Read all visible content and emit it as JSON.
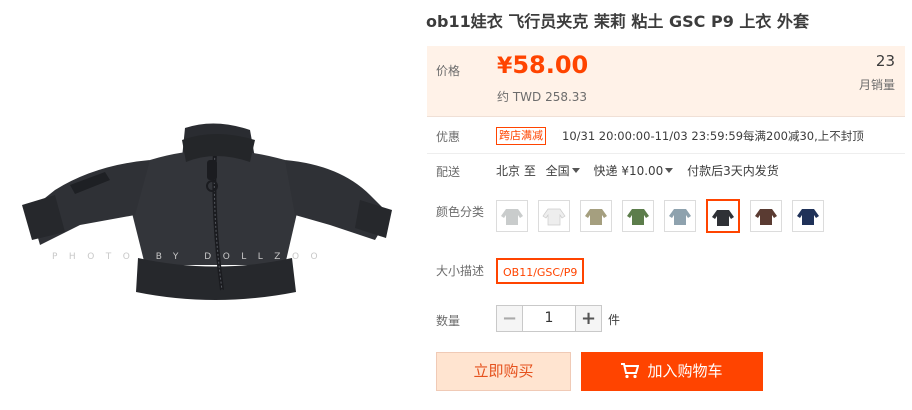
{
  "product": {
    "title": "ob11娃衣 飞行员夹克 茉莉 粘土 GSC P9 上衣 外套",
    "image": {
      "watermark": "PHOTO BY DOLLZOO",
      "icon": "jacket-photo"
    }
  },
  "price": {
    "label": "价格",
    "currency": "¥",
    "amount": "58.00",
    "twd": "约 TWD 258.33",
    "sales_count": "23",
    "sales_label": "月销量"
  },
  "promo": {
    "label": "优惠",
    "tag": "跨店满减",
    "text": "10/31 20:00:00-11/03 23:59:59每满200减30,上不封顶"
  },
  "shipping": {
    "label": "配送",
    "from": "北京 至",
    "to": "全国",
    "method": "快递 ¥10.00",
    "note": "付款后3天内发货"
  },
  "color": {
    "label": "颜色分类",
    "options": [
      {
        "name": "light-gray",
        "color": "#c9cccc"
      },
      {
        "name": "white",
        "color": "#eeeeee"
      },
      {
        "name": "khaki",
        "color": "#a59f7f"
      },
      {
        "name": "green",
        "color": "#5c7d4b"
      },
      {
        "name": "blue-gray",
        "color": "#8ea2ae"
      },
      {
        "name": "black",
        "color": "#2f3136"
      },
      {
        "name": "brown",
        "color": "#5a3b32"
      },
      {
        "name": "navy",
        "color": "#1f3158"
      }
    ],
    "selected_index": 5
  },
  "size": {
    "label": "大小描述",
    "option": "OB11/GSC/P9"
  },
  "quantity": {
    "label": "数量",
    "value": "1",
    "unit": "件"
  },
  "actions": {
    "buy_now": "立即购买",
    "add_cart": "加入购物车"
  },
  "colors": {
    "accent": "#ff4400",
    "price_bg": "#fff2e8"
  }
}
